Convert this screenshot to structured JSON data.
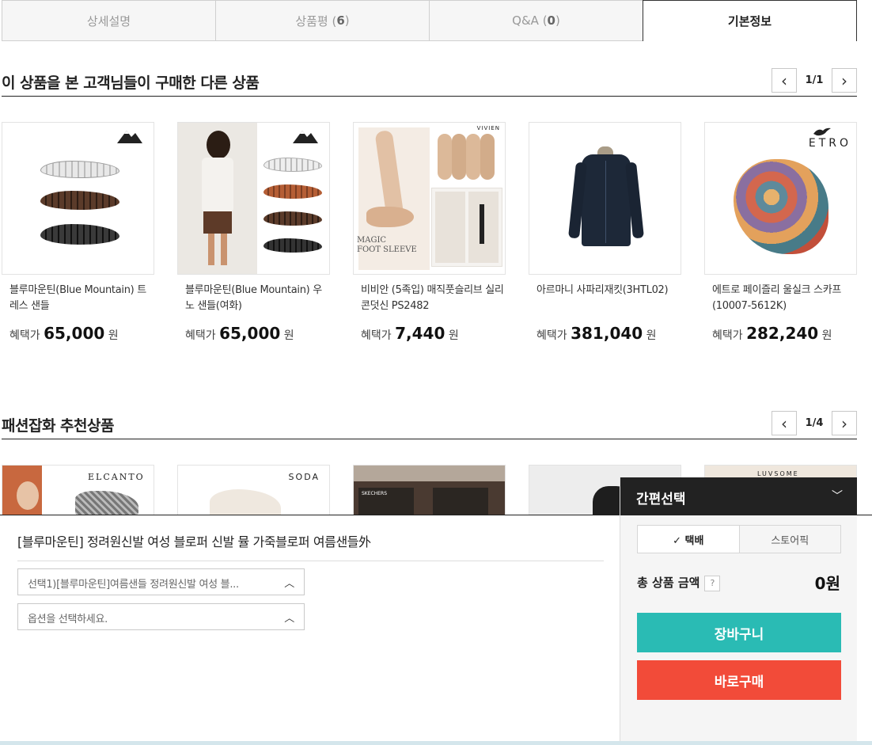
{
  "tabs": [
    {
      "label": "상세설명",
      "count": ""
    },
    {
      "label": "상품평 (",
      "count": "6",
      "suffix": ")"
    },
    {
      "label": "Q&A (",
      "count": "0",
      "suffix": ")"
    },
    {
      "label": "기본정보",
      "count": ""
    }
  ],
  "section1": {
    "title": "이 상품을 본 고객님들이 구매한 다른 상품",
    "page": "1/1",
    "products": [
      {
        "name": "블루마운틴(Blue Mountain) 트레스 샌들",
        "price_label": "혜택가",
        "price": "65,000",
        "unit": "원"
      },
      {
        "name": "블루마운틴(Blue Mountain) 우노 샌들(여화)",
        "price_label": "혜택가",
        "price": "65,000",
        "unit": "원"
      },
      {
        "name": "비비안 (5족입) 매직풋슬리브 실리콘덧신 PS2482",
        "price_label": "혜택가",
        "price": "7,440",
        "unit": "원"
      },
      {
        "name": "아르마니 사파리재킷(3HTL02)",
        "price_label": "혜택가",
        "price": "381,040",
        "unit": "원"
      },
      {
        "name": "에트로 페이즐리 울실크 스카프(10007-5612K)",
        "price_label": "혜택가",
        "price": "282,240",
        "unit": "원"
      }
    ],
    "thumb_text": {
      "vivien": "VIVIEN",
      "magic": "MAGIC",
      "foot_sleeve": "FOOT SLEEVE",
      "etro": "ETRO"
    }
  },
  "section2": {
    "title": "패션잡화 추천상품",
    "page": "1/4",
    "thumb_text": {
      "elcanto": "ELCANTO",
      "soda": "SODA",
      "skechers": "SKECHERS",
      "luvsome": "LUVSOME"
    }
  },
  "option_bar": {
    "product_title": "[블루마운틴] 정려원신발 여성 블로퍼 신발 뮬 가죽블로퍼 여름샌들外",
    "select1": "선택1)[블루마운틴]여름샌들 정려원신발 여성 블...",
    "select2": "옵션을 선택하세요."
  },
  "quick_panel": {
    "title": "간편선택",
    "ship_delivery": "✓ 택배",
    "ship_pickup": "스토어픽",
    "total_label": "총 상품 금액",
    "help": "?",
    "total_value": "0원",
    "cart_label": "장바구니",
    "buy_label": "바로구매"
  },
  "icons": {
    "prev": "‹",
    "next": "›",
    "chevron_up": "︿",
    "chevron_down": "﹀"
  }
}
